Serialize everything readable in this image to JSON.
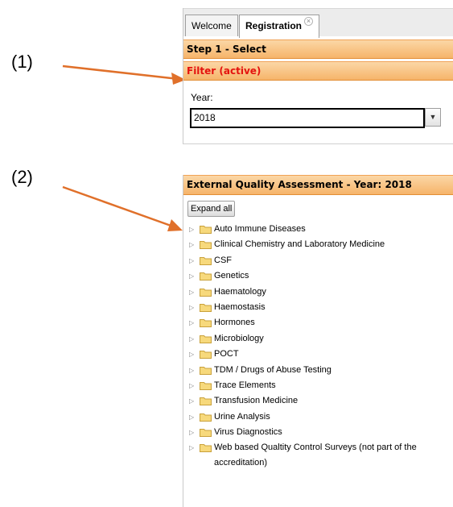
{
  "annotations": {
    "label_1": "(1)",
    "label_2": "(2)"
  },
  "colors": {
    "arrow": "#e0702a",
    "header_gradient_top": "#fbd7a6",
    "header_gradient_bottom": "#f6b46a",
    "active_filter_text": "#e4120e",
    "folder": "#f7d97c"
  },
  "tabs": [
    {
      "label": "Welcome",
      "active": false
    },
    {
      "label": "Registration",
      "active": true,
      "close_icon": "close-icon"
    }
  ],
  "step_header": "Step 1 - Select",
  "filter_header": "Filter (active)",
  "year_field": {
    "label": "Year:",
    "value": "2018",
    "dropdown_icon": "chevron-down-icon"
  },
  "eqa_panel": {
    "title": "External Quality Assessment - Year: 2018",
    "expand_all_label": "Expand all",
    "folder_icon": "folder-icon",
    "expander_icon": "triangle-right-icon",
    "items": [
      "Auto Immune Diseases",
      "Clinical Chemistry and Laboratory Medicine",
      "CSF",
      "Genetics",
      "Haematology",
      "Haemostasis",
      "Hormones",
      "Microbiology",
      "POCT",
      "TDM / Drugs of Abuse Testing",
      "Trace Elements",
      "Transfusion Medicine",
      "Urine Analysis",
      "Virus Diagnostics",
      "Web based Qualtity Control Surveys (not part of the accreditation)"
    ]
  }
}
